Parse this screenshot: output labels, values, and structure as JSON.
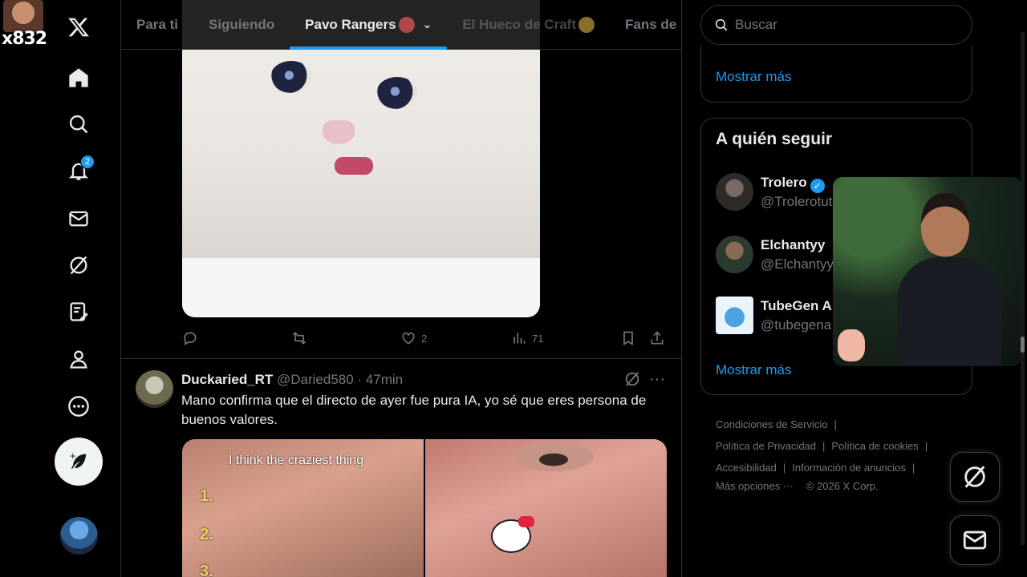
{
  "overlay": {
    "stream_tag": "x832"
  },
  "nav": {
    "notifications_badge": "2",
    "items": [
      "x-logo-icon",
      "home-icon",
      "search-icon",
      "bell-icon",
      "mail-icon",
      "grok-icon",
      "premium-icon",
      "profile-icon",
      "more-icon"
    ]
  },
  "tabs": [
    {
      "label": "Para ti"
    },
    {
      "label": "Siguiendo"
    },
    {
      "label": "Pavo Rangers"
    },
    {
      "label": "El Hueco de Craft"
    },
    {
      "label": "Fans de"
    }
  ],
  "tweet1": {
    "likes": "2",
    "views": "71"
  },
  "tweet2": {
    "name": "Duckaried_RT",
    "handle": "@Daried580 · 47min",
    "text": "Mano confirma que el directo de ayer fue pura IA, yo sé que eres persona de buenos valores.",
    "media_overlay_text": "I think the craziest thing",
    "media_numbers": [
      "1.",
      "2.",
      "3."
    ]
  },
  "right": {
    "search_placeholder": "Buscar",
    "show_more_1": "Mostrar más",
    "who_to_follow_title": "A quién seguir",
    "follow": [
      {
        "name": "Trolero",
        "handle": "@Trolerotut",
        "verified": true
      },
      {
        "name": "Elchantyy",
        "handle": "@Elchantyy",
        "verified": false
      },
      {
        "name": "TubeGen A",
        "handle": "@tubegena",
        "verified": false
      }
    ],
    "show_more_2": "Mostrar más",
    "footer": {
      "terms": "Condiciones de Servicio",
      "privacy": "Política de Privacidad",
      "cookies": "Política de cookies",
      "accessibility": "Accesibilidad",
      "ads_info": "Información de anuncios",
      "more": "Más opciones ···",
      "copyright": "© 2026 X Corp."
    }
  },
  "colors": {
    "accent": "#1d9bf0",
    "background": "#000000",
    "text": "#e7e9ea",
    "muted": "#71767b",
    "border": "#2f3336"
  }
}
